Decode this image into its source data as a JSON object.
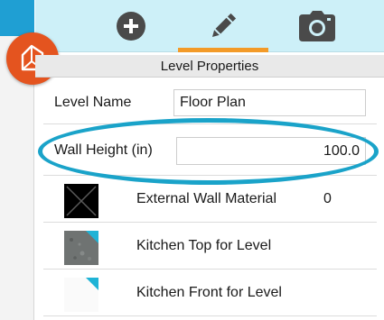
{
  "toolbar": {
    "tools": [
      {
        "name": "add-icon",
        "active": false
      },
      {
        "name": "pencil-icon",
        "active": true
      },
      {
        "name": "camera-icon",
        "active": false
      }
    ],
    "accent": "#f39a28",
    "background": "#cdf0f8"
  },
  "app": {
    "logo_icon": "house-3d-icon",
    "logo_color": "#e4541f"
  },
  "panel": {
    "title": "Level Properties",
    "level_name": {
      "label": "Level Name",
      "value": "Floor Plan"
    },
    "wall_height": {
      "label": "Wall Height (in)",
      "value": "100.0"
    },
    "materials": [
      {
        "label": "External Wall Material",
        "value": "0",
        "swatch": "black-x-swatch"
      },
      {
        "label": "Kitchen Top for Level",
        "value": "",
        "swatch": "granite-swatch"
      },
      {
        "label": "Kitchen Front for Level",
        "value": "",
        "swatch": "white-swatch"
      }
    ]
  },
  "highlight_color": "#1aa3c9"
}
